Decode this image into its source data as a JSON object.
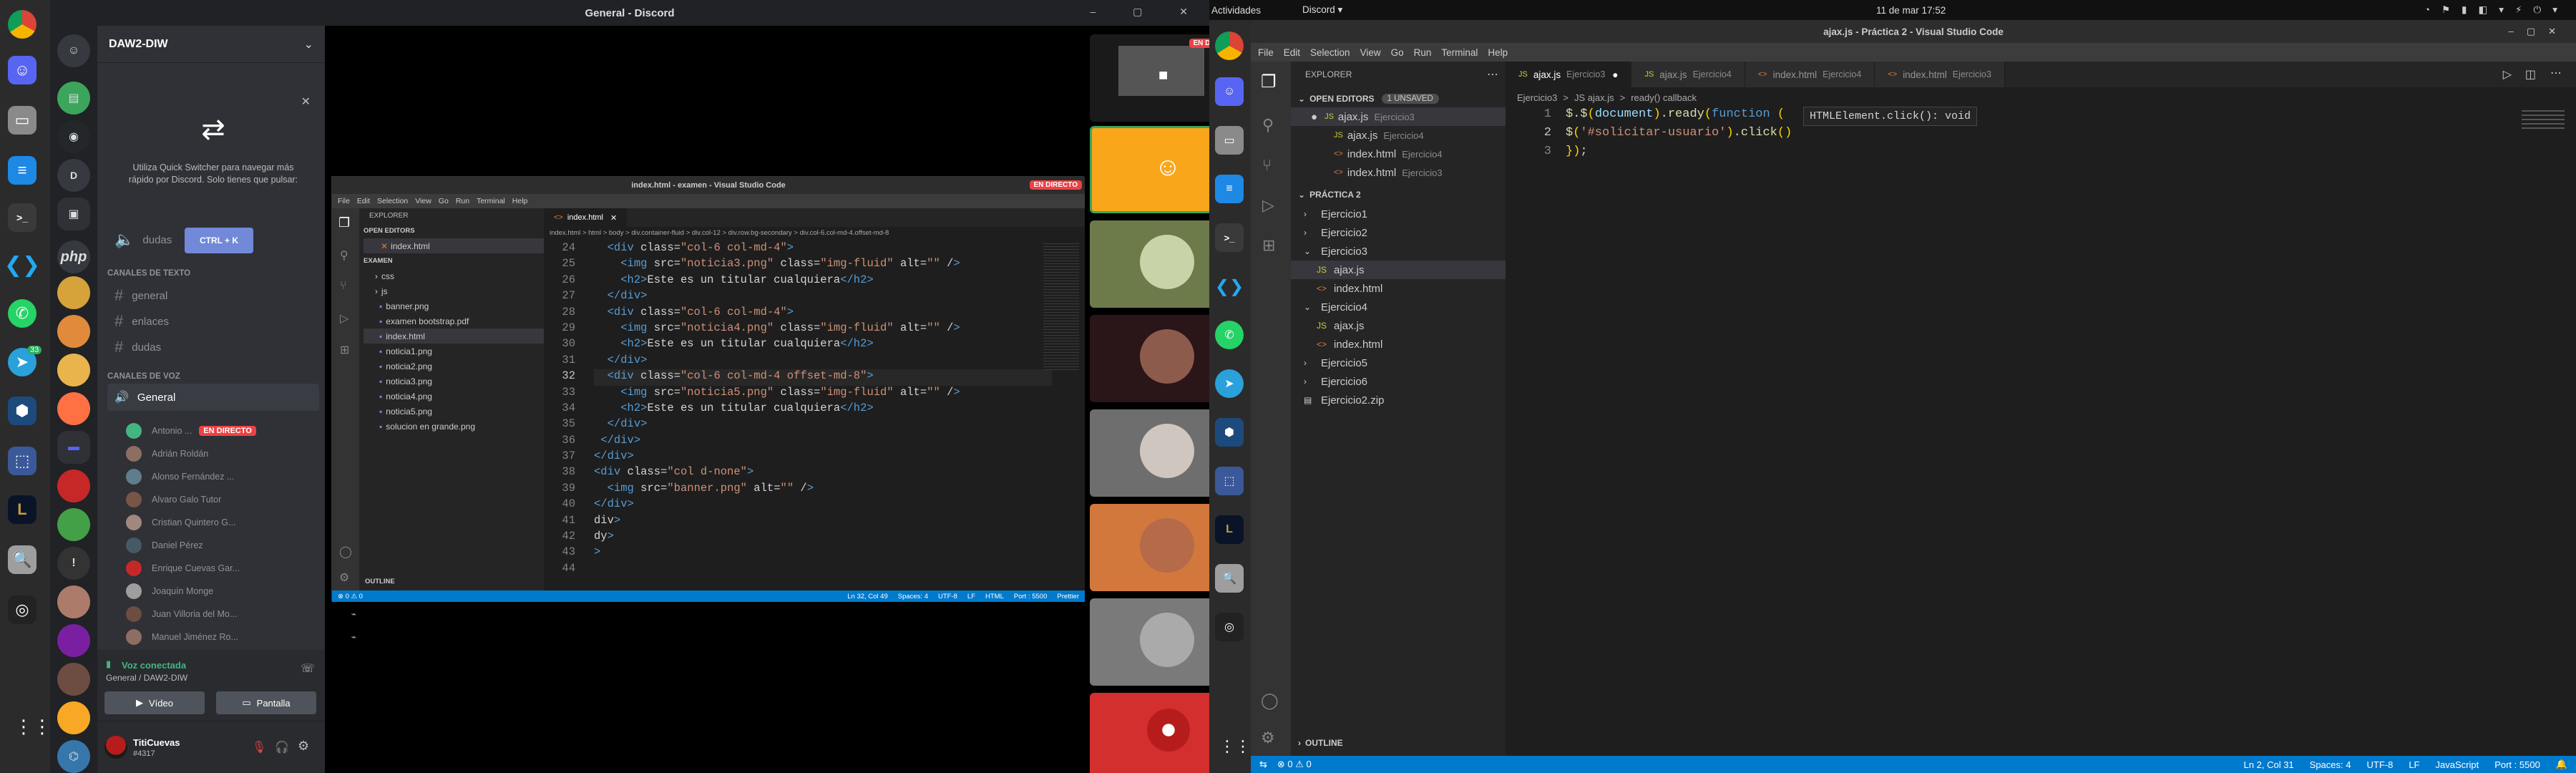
{
  "left_window": {
    "title": "General - Discord",
    "window_controls": [
      "–",
      "▢",
      "✕"
    ]
  },
  "discord": {
    "server_name": "DAW2-DIW",
    "quick_switcher": {
      "text": "Utiliza Quick Switcher para navegar más rápido por Discord. Solo tienes que pulsar:",
      "shortcut": "CTRL + K"
    },
    "top_channel": "dudas",
    "text_category": "CANALES DE TEXTO",
    "text_channels": [
      "general",
      "enlaces",
      "dudas"
    ],
    "voice_category": "CANALES DE VOZ",
    "voice_channel": "General",
    "voice_users": [
      {
        "name": "Antonio ...",
        "live": "EN DIRECTO",
        "color": "#43b581"
      },
      {
        "name": "Adrián Roldán",
        "color": "#8d6e63"
      },
      {
        "name": "Alonso Fernández ...",
        "color": "#607d8b"
      },
      {
        "name": "Alvaro Galo Tutor",
        "color": "#795548"
      },
      {
        "name": "Cristian Quintero G...",
        "color": "#a1887f"
      },
      {
        "name": "Daniel Pérez",
        "color": "#455a64"
      },
      {
        "name": "Enrique Cuevas Gar...",
        "color": "#c62828"
      },
      {
        "name": "Joaquín Monge",
        "color": "#9e9e9e"
      },
      {
        "name": "Juan Villoria del Mo...",
        "color": "#6d4c41"
      },
      {
        "name": "Manuel Jiménez Ro...",
        "color": "#8d6e63"
      }
    ],
    "voice_connected": "Voz conectada",
    "voice_location": "General / DAW2-DIW",
    "video_btn": "Vídeo",
    "screen_btn": "Pantalla",
    "user_name": "TitiCuevas",
    "user_tag": "#4317",
    "badge_count": "33"
  },
  "stream": {
    "title": "index.html - examen - Visual Studio Code",
    "live_badge": "EN DIRECTO",
    "menu": [
      "File",
      "Edit",
      "Selection",
      "View",
      "Go",
      "Run",
      "Terminal",
      "Help"
    ],
    "explorer_label": "EXPLORER",
    "open_editors": "OPEN EDITORS",
    "open_file": "index.html",
    "folder": "EXAMEN",
    "files": [
      "css",
      "js",
      "banner.png",
      "examen bootstrap.pdf",
      "index.html",
      "noticia1.png",
      "noticia2.png",
      "noticia3.png",
      "noticia4.png",
      "noticia5.png",
      "solucion en grande.png"
    ],
    "outline": "OUTLINE",
    "tab": "index.html",
    "breadcrumb": "index.html > html > body > div.container-fluid > div.col-12 > div.row.bg-secondary > div.col-6.col-md-4.offset-md-8",
    "line_numbers": [
      "24",
      "25",
      "26",
      "27",
      "28",
      "29",
      "30",
      "31",
      "32",
      "33",
      "34",
      "35",
      "36",
      "37",
      "38",
      "39",
      "40",
      "41",
      "42",
      "43",
      "44"
    ],
    "code": [
      "  <div class=\"col-6 col-md-4\">",
      "    <img src=\"noticia3.png\" class=\"img-fluid\" alt=\"\" />",
      "    <h2>Este es un titular cualquiera</h2>",
      "  </div>",
      "  <div class=\"col-6 col-md-4\">",
      "    <img src=\"noticia4.png\" class=\"img-fluid\" alt=\"\" />",
      "    <h2>Este es un titular cualquiera</h2>",
      "  </div>",
      "  <div class=\"col-6 col-md-4 offset-md-8\">",
      "    <img src=\"noticia5.png\" class=\"img-fluid\" alt=\"\" />",
      "    <h2>Este es un titular cualquiera</h2>",
      "  </div>",
      " </div>",
      "</div>",
      "<div class=\"col d-none\">",
      "  <img src=\"banner.png\" alt=\"\" />",
      "</div>",
      "div>",
      "dy>",
      ">",
      ""
    ],
    "status_left": "⊗ 0 ⚠ 0",
    "status_right": [
      "Ln 32, Col 49",
      "Spaces: 4",
      "UTF-8",
      "LF",
      "HTML",
      "Port : 5500",
      "Prettier"
    ]
  },
  "participants": {
    "top_live": "EN DIRECTO"
  },
  "topbar": {
    "activities": "Actividades",
    "app": "Discord ▾",
    "clock": "11 de mar 17:52"
  },
  "vscode": {
    "title": "ajax.js - Práctica 2 - Visual Studio Code",
    "menu": [
      "File",
      "Edit",
      "Selection",
      "View",
      "Go",
      "Run",
      "Terminal",
      "Help"
    ],
    "explorer": "EXPLORER",
    "open_editors": "OPEN EDITORS",
    "unsaved": "1 UNSAVED",
    "open_editor_items": [
      {
        "name": "ajax.js",
        "dir": "Ejercicio3"
      },
      {
        "name": "ajax.js",
        "dir": "Ejercicio4"
      },
      {
        "name": "index.html",
        "dir": "Ejercicio4"
      },
      {
        "name": "index.html",
        "dir": "Ejercicio3"
      }
    ],
    "project": "PRÁCTICA 2",
    "tree": [
      {
        "label": "Ejercicio1",
        "indent": 0,
        "kind": "folder-closed"
      },
      {
        "label": "Ejercicio2",
        "indent": 0,
        "kind": "folder-closed"
      },
      {
        "label": "Ejercicio3",
        "indent": 0,
        "kind": "folder-open"
      },
      {
        "label": "ajax.js",
        "indent": 1,
        "kind": "js"
      },
      {
        "label": "index.html",
        "indent": 1,
        "kind": "html"
      },
      {
        "label": "Ejercicio4",
        "indent": 0,
        "kind": "folder-open"
      },
      {
        "label": "ajax.js",
        "indent": 1,
        "kind": "js"
      },
      {
        "label": "index.html",
        "indent": 1,
        "kind": "html"
      },
      {
        "label": "Ejercicio5",
        "indent": 0,
        "kind": "folder-closed"
      },
      {
        "label": "Ejercicio6",
        "indent": 0,
        "kind": "folder-closed"
      },
      {
        "label": "Ejercicio2.zip",
        "indent": 0,
        "kind": "file"
      }
    ],
    "outline": "OUTLINE",
    "tabs": [
      {
        "name": "ajax.js",
        "dir": "Ejercicio3",
        "active": true
      },
      {
        "name": "ajax.js",
        "dir": "Ejercicio4"
      },
      {
        "name": "index.html",
        "dir": "Ejercicio4"
      },
      {
        "name": "index.html",
        "dir": "Ejercicio3"
      }
    ],
    "breadcrumb": [
      "Ejercicio3",
      ">",
      "JS ajax.js",
      ">",
      "ready() callback"
    ],
    "line_numbers": [
      "1",
      "2",
      "3"
    ],
    "code": [
      "$.$(document).ready(function ( ",
      "$('#solicitar-usuario').click()",
      "});"
    ],
    "hover": "HTMLElement.click(): void",
    "status_left": "⊗ 0 ⚠ 0",
    "status_right": [
      "Ln 2, Col 31",
      "Spaces: 4",
      "UTF-8",
      "LF",
      "JavaScript",
      "Port : 5500"
    ]
  }
}
